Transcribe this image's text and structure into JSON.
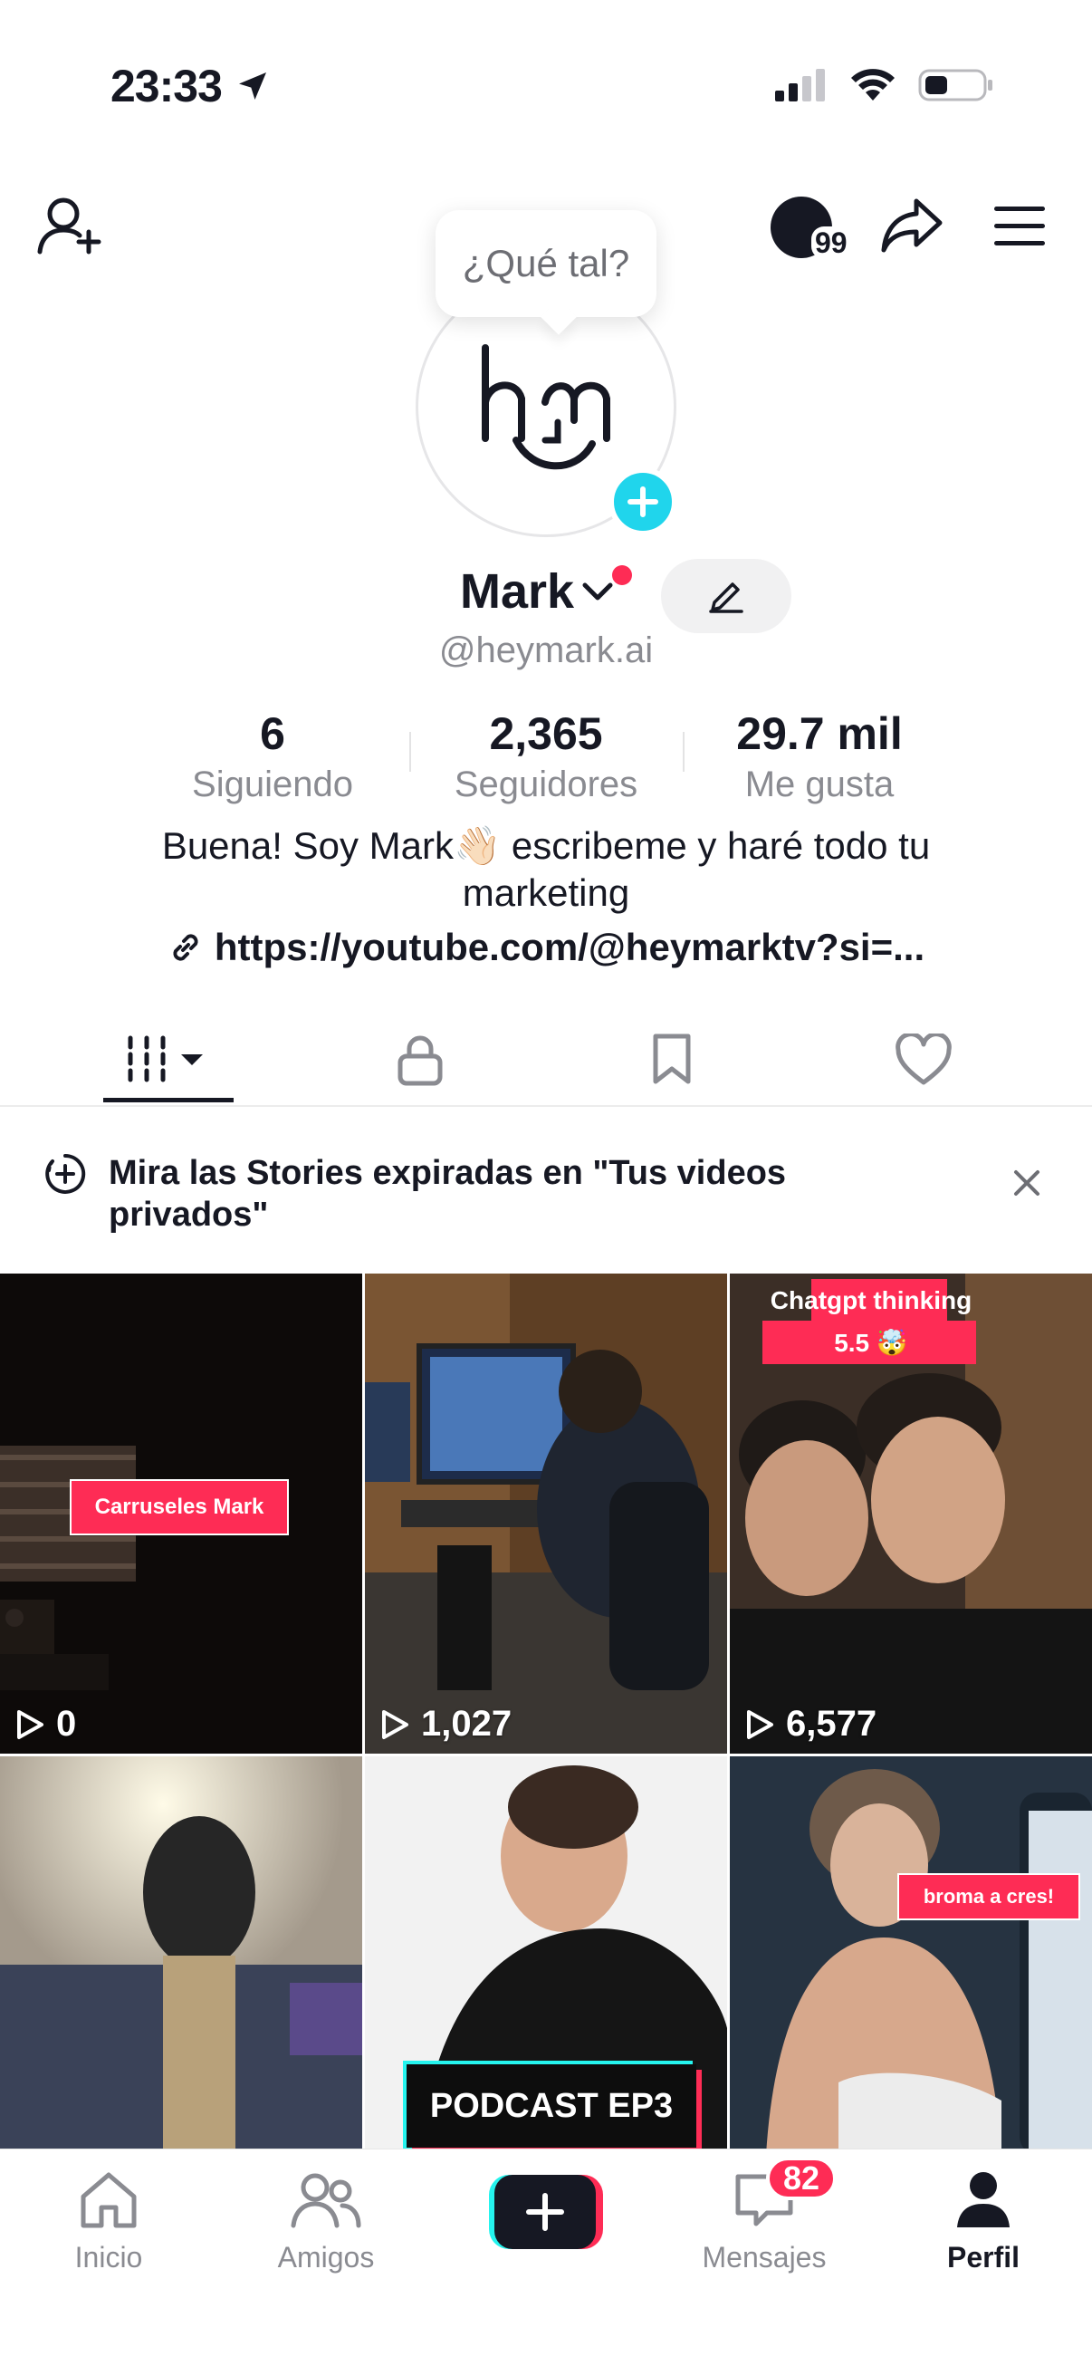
{
  "status": {
    "time": "23:33"
  },
  "profile": {
    "tooltip": "¿Qué tal?",
    "name": "Mark",
    "handle": "@heymark.ai",
    "stats": [
      {
        "value": "6",
        "label": "Siguiendo"
      },
      {
        "value": "2,365",
        "label": "Seguidores"
      },
      {
        "value": "29.7 mil",
        "label": "Me gusta"
      }
    ],
    "bio_line1": "Buena! Soy Mark👋🏻 escribeme y haré todo tu",
    "bio_line2": "marketing",
    "link": "https://youtube.com/@heymarktv?si=..."
  },
  "header": {
    "story_count": "99"
  },
  "banner": {
    "text": "Mira las Stories expiradas en \"Tus videos privados\""
  },
  "videos": [
    {
      "overlay": "Carruseles Mark",
      "views": "0"
    },
    {
      "overlay": "",
      "views": "1,027"
    },
    {
      "overlay": "Chatgpt thinking 5.5 🤯",
      "views": "6,577"
    },
    {
      "overlay": "",
      "views": ""
    },
    {
      "overlay": "PODCAST EP3",
      "views": ""
    },
    {
      "overlay": "broma a cres!",
      "views": ""
    }
  ],
  "nav": {
    "items": [
      {
        "label": "Inicio"
      },
      {
        "label": "Amigos"
      },
      {
        "label": "Mensajes"
      },
      {
        "label": "Perfil"
      }
    ],
    "messages_badge": "82"
  },
  "colors": {
    "accent_red": "#fe2c55",
    "accent_cyan": "#20d5ec",
    "text": "#161823",
    "muted": "#8a8b91"
  }
}
